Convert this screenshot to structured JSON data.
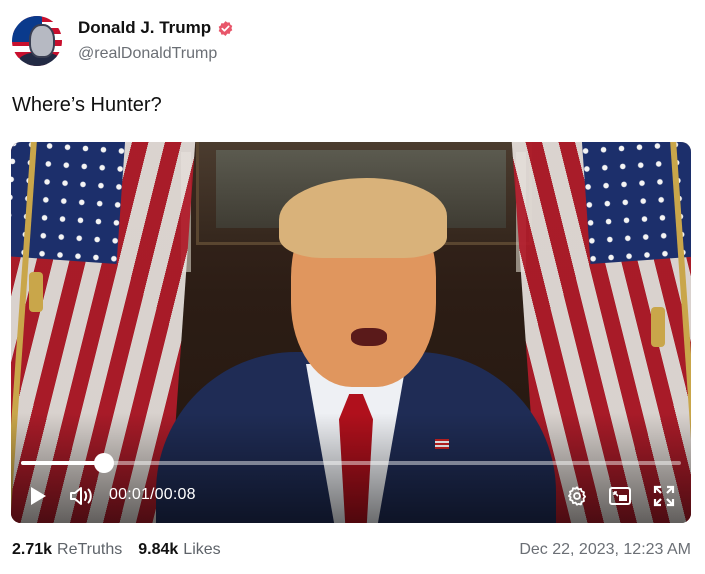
{
  "author": {
    "name": "Donald J. Trump",
    "handle": "@realDonaldTrump",
    "verified": true
  },
  "post": {
    "text": "Where’s Hunter?"
  },
  "video": {
    "current_time": "00:01",
    "duration": "00:08",
    "time_display": "00:01/00:08",
    "progress_fraction": 0.125
  },
  "stats": {
    "retruths_count": "2.71k",
    "retruths_label": "ReTruths",
    "likes_count": "9.84k",
    "likes_label": "Likes"
  },
  "timestamp": "Dec 22, 2023, 12:23 AM",
  "colors": {
    "verified_badge": "#e8566a",
    "text_primary": "#111111",
    "text_secondary": "#6b6f75"
  },
  "icons": [
    "verified-badge-icon",
    "play-icon",
    "volume-icon",
    "settings-gear-icon",
    "picture-in-picture-icon",
    "fullscreen-icon"
  ]
}
